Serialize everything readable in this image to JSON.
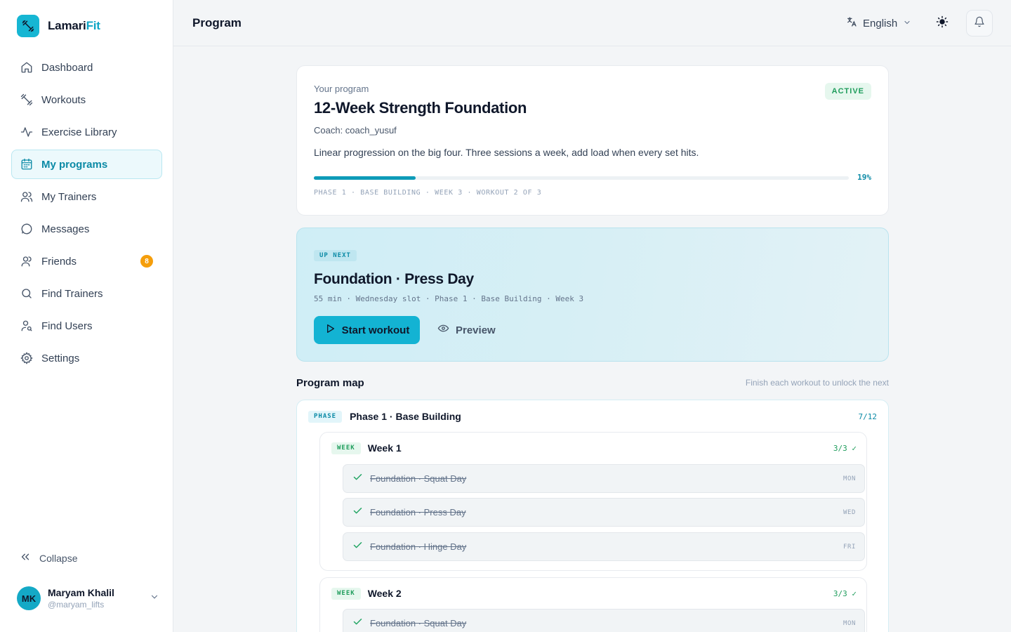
{
  "app": {
    "name_main": "Lamari",
    "name_accent": "Fit"
  },
  "sidebar": {
    "items": [
      {
        "label": "Dashboard"
      },
      {
        "label": "Workouts"
      },
      {
        "label": "Exercise Library"
      },
      {
        "label": "My programs"
      },
      {
        "label": "My Trainers"
      },
      {
        "label": "Messages"
      },
      {
        "label": "Friends",
        "badge": "8"
      },
      {
        "label": "Find Trainers"
      },
      {
        "label": "Find Users"
      },
      {
        "label": "Settings"
      }
    ],
    "collapse_label": "Collapse"
  },
  "user": {
    "initials": "MK",
    "name": "Maryam Khalil",
    "handle": "@maryam_lifts"
  },
  "header": {
    "title": "Program",
    "language": "English"
  },
  "program": {
    "kicker": "Your program",
    "title": "12-Week Strength Foundation",
    "coach": "Coach: coach_yusuf",
    "description": "Linear progression on the big four. Three sessions a week, add load when every set hits.",
    "status": "ACTIVE",
    "progress_pct": "19%",
    "progress_value": 0.19,
    "progress_meta": "PHASE 1 · BASE BUILDING · WEEK 3 · WORKOUT 2 OF 3"
  },
  "up_next": {
    "tag": "UP NEXT",
    "title": "Foundation · Press Day",
    "meta": "55 min · Wednesday slot · Phase 1 · Base Building · Week 3",
    "start_label": "Start workout",
    "preview_label": "Preview"
  },
  "map": {
    "title": "Program map",
    "hint": "Finish each workout to unlock the next",
    "phase": {
      "pill": "PHASE",
      "name": "Phase 1 · Base Building",
      "count": "7/12",
      "weeks": [
        {
          "pill": "WEEK",
          "name": "Week 1",
          "count": "3/3 ✓",
          "workouts": [
            {
              "name": "Foundation · Squat Day",
              "day": "MON"
            },
            {
              "name": "Foundation · Press Day",
              "day": "WED"
            },
            {
              "name": "Foundation · Hinge Day",
              "day": "FRI"
            }
          ]
        },
        {
          "pill": "WEEK",
          "name": "Week 2",
          "count": "3/3 ✓",
          "workouts": [
            {
              "name": "Foundation · Squat Day",
              "day": "MON"
            }
          ]
        }
      ]
    }
  },
  "colors": {
    "accent": "#13b3d3",
    "accent_dark": "#0b8aa6",
    "success": "#1f9d5c",
    "badge": "#f59e0b"
  }
}
